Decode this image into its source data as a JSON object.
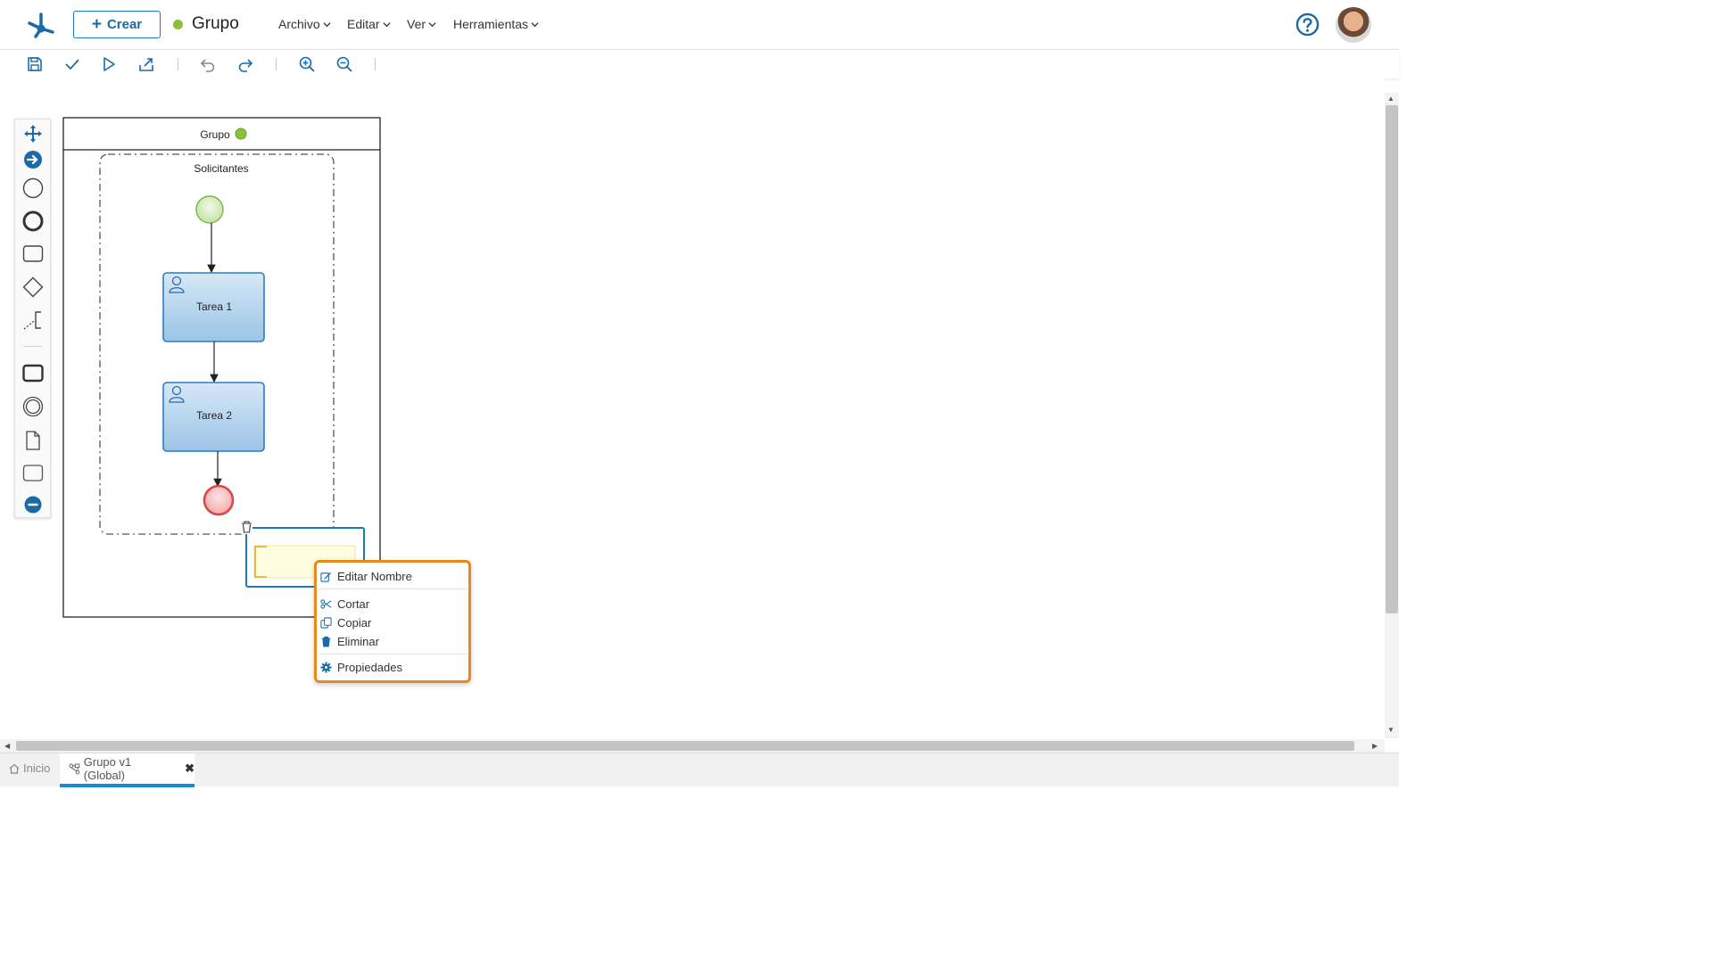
{
  "header": {
    "create_label": "Crear",
    "create_icon": "plus-icon",
    "title": "Grupo",
    "status_color": "#8cbf3a",
    "menus": [
      "Archivo",
      "Editar",
      "Ver",
      "Herramientas"
    ]
  },
  "toolbar": {
    "buttons": [
      "save-icon",
      "check-icon",
      "play-icon",
      "export-icon",
      "undo-icon",
      "redo-icon",
      "zoom-in-icon",
      "zoom-out-icon"
    ]
  },
  "palette": {
    "tools": [
      "move-icon",
      "connect-arrow-icon",
      "start-event-icon",
      "end-event-icon",
      "task-icon",
      "gateway-icon",
      "annotation-icon",
      "subprocess-icon",
      "intermediate-event-icon",
      "document-icon",
      "group-icon",
      "collapse-icon"
    ]
  },
  "diagram": {
    "pool_label": "Grupo",
    "pool_status_color": "#8cbf3a",
    "lane_label": "Solicitantes",
    "task1_label": "Tarea 1",
    "task2_label": "Tarea 2"
  },
  "context_menu": {
    "edit_name": "Editar Nombre",
    "cut": "Cortar",
    "copy": "Copiar",
    "delete": "Eliminar",
    "properties": "Propiedades"
  },
  "tabs": {
    "home": "Inicio",
    "active": "Grupo v1 (Global)",
    "close": "✖"
  },
  "colors": {
    "accent": "#1b7bc0",
    "menu_border": "#e8891c",
    "active_tab": "#1b8ad6"
  }
}
